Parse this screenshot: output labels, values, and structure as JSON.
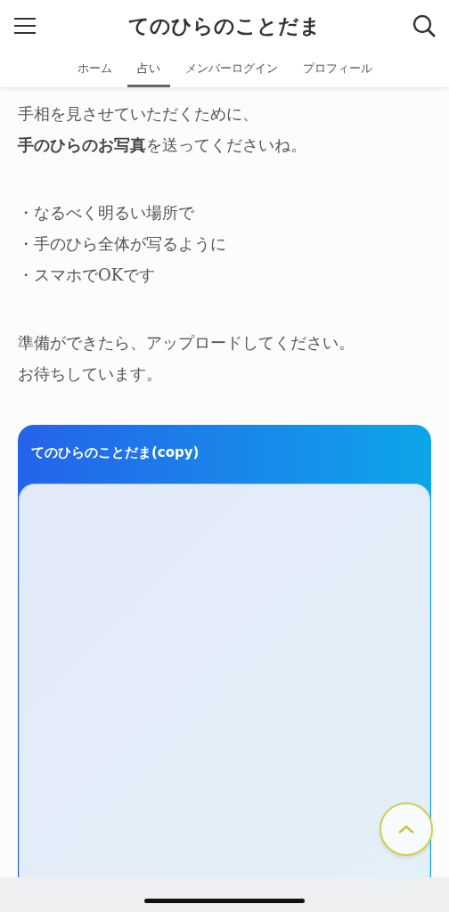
{
  "header": {
    "title": "てのひらのことだま"
  },
  "tabs": [
    {
      "label": "ホーム",
      "selected": false
    },
    {
      "label": "占い",
      "selected": true
    },
    {
      "label": "メンバーログイン",
      "selected": false
    },
    {
      "label": "プロフィール",
      "selected": false
    }
  ],
  "intro": [
    "手相を見させていただくために、",
    "**手のひらのお写真**を送ってくださいね。"
  ],
  "bullets": [
    "・なるべく明るい場所で",
    "・手のひら全体が写るように",
    "・スマホでOKです"
  ],
  "closing": [
    "準備ができたら、アップロードしてください。",
    "お待ちしています。"
  ],
  "card": {
    "title": "てのひらのことだま(copy)"
  }
}
